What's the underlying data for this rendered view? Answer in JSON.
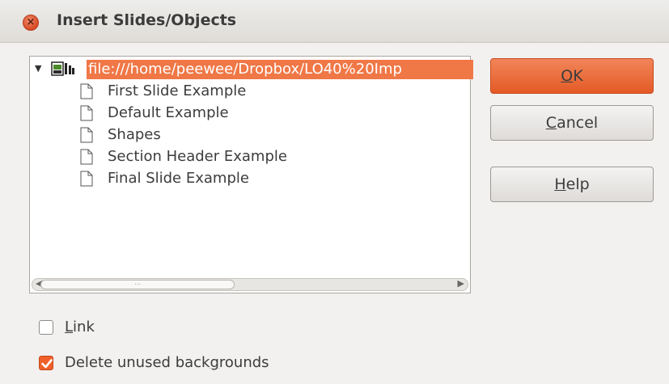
{
  "window": {
    "title": "Insert Slides/Objects",
    "close_glyph": "×"
  },
  "tree": {
    "root": {
      "expander": "▼",
      "icon": "presentation-file-icon",
      "label": "file:///home/peewee/Dropbox/LO40%20Imp"
    },
    "items": [
      {
        "label": "First Slide Example",
        "icon": "document-icon"
      },
      {
        "label": "Default Example",
        "icon": "document-icon"
      },
      {
        "label": "Shapes",
        "icon": "document-icon"
      },
      {
        "label": "Section Header Example",
        "icon": "document-icon"
      },
      {
        "label": "Final Slide Example",
        "icon": "document-icon"
      }
    ],
    "scrollbar": {
      "left_arrow": "◀",
      "right_arrow": "▶",
      "thumb_grip": "⋯"
    }
  },
  "buttons": {
    "ok": {
      "mnemonic": "O",
      "rest": "K"
    },
    "cancel": {
      "mnemonic": "C",
      "rest": "ancel"
    },
    "help": {
      "mnemonic": "H",
      "rest": "elp"
    }
  },
  "options": {
    "link": {
      "mnemonic": "L",
      "rest": "ink",
      "checked": false
    },
    "delete_unused": {
      "before": "Delete unused back",
      "mnemonic": "g",
      "after": "rounds",
      "checked": true
    }
  },
  "colors": {
    "accent": "#f07746",
    "default_button": "#e35a25",
    "check_fill": "#f0602a"
  }
}
